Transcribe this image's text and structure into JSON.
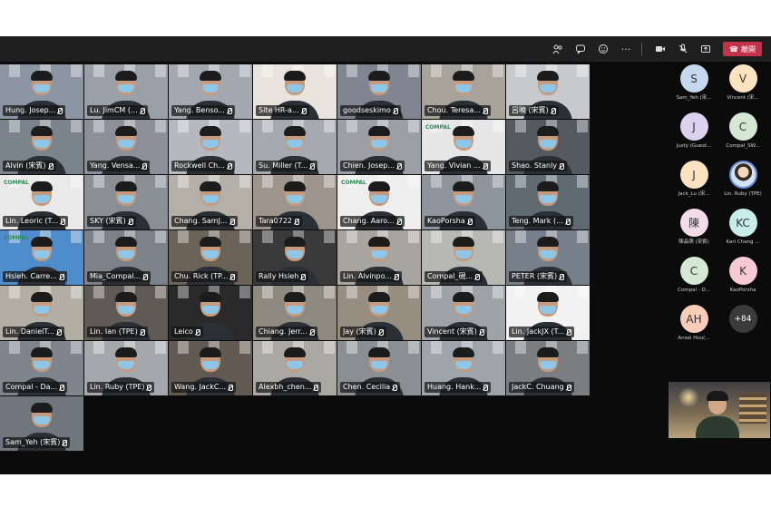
{
  "toolbar": {
    "icons": [
      "people-icon",
      "chat-icon",
      "reactions-icon",
      "more-icon",
      "camera-icon",
      "mic-off-icon",
      "share-icon"
    ],
    "more_label": "···",
    "leave_label": "離開",
    "accent": "#c4314b"
  },
  "grid": {
    "tiles": [
      {
        "name": "Hung. Josep...",
        "bg": "#8b95a3",
        "logo": ""
      },
      {
        "name": "Lu. JimCM (...",
        "bg": "#9aa0a8",
        "logo": ""
      },
      {
        "name": "Yang. Benso...",
        "bg": "#a3a8b0",
        "logo": ""
      },
      {
        "name": "Site HR-a...",
        "bg": "#e8e3dc",
        "logo": ""
      },
      {
        "name": "goodseskimo",
        "bg": "#7f8691",
        "logo": ""
      },
      {
        "name": "Chou. Teresa...",
        "bg": "#a7a39b",
        "logo": ""
      },
      {
        "name": "呂曉 (宋賓)",
        "bg": "#c7c9cc",
        "logo": ""
      },
      {
        "name": "Alvin (宋賓)",
        "bg": "#7b848c",
        "logo": ""
      },
      {
        "name": "Yang. Vensa...",
        "bg": "#8d9098",
        "logo": ""
      },
      {
        "name": "Rockwell Ch...",
        "bg": "#b5b9bf",
        "logo": ""
      },
      {
        "name": "Su. Miller (T...",
        "bg": "#a6aab0",
        "logo": ""
      },
      {
        "name": "Chien. Josep...",
        "bg": "#9ca0a6",
        "logo": ""
      },
      {
        "name": "Yang. Vivian ...",
        "bg": "#e6e6e6",
        "logo": "COMPAL"
      },
      {
        "name": "Shao. Stanly",
        "bg": "#555a61",
        "logo": ""
      },
      {
        "name": "Lin. Leoric (T...",
        "bg": "#e9e9e9",
        "logo": "COMPAL"
      },
      {
        "name": "SKY (宋賓)",
        "bg": "#8a8f96",
        "logo": ""
      },
      {
        "name": "Chang. SamJ...",
        "bg": "#b4b0a8",
        "logo": ""
      },
      {
        "name": "Tara0722",
        "bg": "#9d958c",
        "logo": ""
      },
      {
        "name": "Chang. Aaro...",
        "bg": "#eeeeee",
        "logo": "COMPAL"
      },
      {
        "name": "KaoPorsha",
        "bg": "#8d949c",
        "logo": ""
      },
      {
        "name": "Teng. Mark (...",
        "bg": "#5f6a73",
        "logo": ""
      },
      {
        "name": "Hsieh. Carre...",
        "bg": "#4f8ccc",
        "logo": "COMPAL"
      },
      {
        "name": "Mia_Compal...",
        "bg": "#7c8289",
        "logo": ""
      },
      {
        "name": "Chu. Rick (TP...",
        "bg": "#6b6258",
        "logo": ""
      },
      {
        "name": "Rally Hsieh",
        "bg": "#3a3a3a",
        "logo": ""
      },
      {
        "name": "Lin. Alvinpo...",
        "bg": "#a8a5a0",
        "logo": ""
      },
      {
        "name": "Compal_硯...",
        "bg": "#b7b7b3",
        "logo": ""
      },
      {
        "name": "PETER (宋賓)",
        "bg": "#77808a",
        "logo": ""
      },
      {
        "name": "Lin. DanielT...",
        "bg": "#b2aea4",
        "logo": ""
      },
      {
        "name": "Lin. Ian (TPE)",
        "bg": "#5f5a55",
        "logo": ""
      },
      {
        "name": "Leico",
        "bg": "#2a2a2a",
        "logo": ""
      },
      {
        "name": "Chiang. Jerr...",
        "bg": "#8f8a80",
        "logo": ""
      },
      {
        "name": "Jay (宋賓)",
        "bg": "#978d80",
        "logo": ""
      },
      {
        "name": "Vincent (宋賓)",
        "bg": "#9fa3a8",
        "logo": ""
      },
      {
        "name": "Lin. JackJX (T...",
        "bg": "#f2f2f2",
        "logo": ""
      },
      {
        "name": "Compal - Da...",
        "bg": "#7e858c",
        "logo": ""
      },
      {
        "name": "Lin. Ruby (TPE)",
        "bg": "#a4a7ab",
        "logo": ""
      },
      {
        "name": "Wang. JackC...",
        "bg": "#625a52",
        "logo": ""
      },
      {
        "name": "Alexbh_chen...",
        "bg": "#aaa8a2",
        "logo": ""
      },
      {
        "name": "Chen. Cecilia",
        "bg": "#8a8f93",
        "logo": ""
      },
      {
        "name": "Huang. Hank...",
        "bg": "#9da4aa",
        "logo": ""
      },
      {
        "name": "JackC. Chuang",
        "bg": "#7b7d80",
        "logo": ""
      }
    ],
    "extra_tile_name": "Sam_Yeh (宋賓)",
    "highlight_color": "#ffffff"
  },
  "roster": {
    "people": [
      {
        "initials": "S",
        "name": "Sam_Yeh (宋...",
        "color": "#c5d9ee"
      },
      {
        "initials": "V",
        "name": "Vincent (宋...",
        "color": "#fbe3c2"
      },
      {
        "initials": "J",
        "name": "Justy (Guest...",
        "color": "#d9d3f0"
      },
      {
        "initials": "C",
        "name": "Compal_SW...",
        "color": "#d4e8d4"
      },
      {
        "initials": "J",
        "name": "Jack_Lu (宋...",
        "color": "#fbe3c2"
      },
      {
        "initials": "",
        "name": "Lin. Ruby (TPE)",
        "color": "#cfe3f2"
      },
      {
        "initials": "陳",
        "name": "陳品萌 (宋賓)",
        "color": "#f4dbe8"
      },
      {
        "initials": "KC",
        "name": "Kari Chang ...",
        "color": "#c8ecea"
      },
      {
        "initials": "C",
        "name": "Compal - D...",
        "color": "#d4e8d4"
      },
      {
        "initials": "K",
        "name": "KaoPorsha",
        "color": "#f6c9d6"
      },
      {
        "initials": "AH",
        "name": "Ansel Hou(...",
        "color": "#f7cdb9"
      },
      {
        "initials": "+84",
        "name": "",
        "color": "#3b3b3b"
      }
    ]
  }
}
